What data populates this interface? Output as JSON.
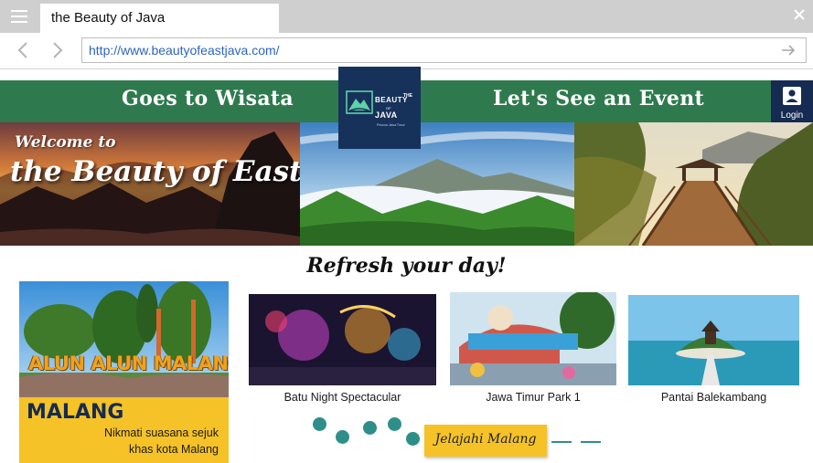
{
  "browser": {
    "tab_title": "the Beauty of Java",
    "url": "http://www.beautyofeastjava.com/",
    "icons": {
      "menu": "hamburger-menu-icon",
      "close": "close-icon",
      "back": "arrow-left-icon",
      "forward": "arrow-right-icon",
      "go": "arrow-go-icon"
    }
  },
  "site_nav": {
    "left_link": "Goes to Wisata",
    "right_link": "Let's See an Event",
    "login_label": "Login",
    "background_color": "#2e7a4e"
  },
  "logo": {
    "the": "THE",
    "beauty": "BEAUTY",
    "of": "OF",
    "java": "JAVA",
    "subtitle": "Pesona Jawa Timur",
    "background_color": "#17325a"
  },
  "hero": {
    "welcome": "Welcome to",
    "title": "the Beauty of East Java"
  },
  "main": {
    "tagline": "Refresh your day!",
    "featured": {
      "photo_sign": "ALUN ALUN MALANG",
      "city": "MALANG",
      "description_line1": "Nikmati suasana sejuk",
      "description_line2": "khas kota Malang",
      "card_color": "#f5c228"
    },
    "places": [
      {
        "label": "Batu Night Spectacular"
      },
      {
        "label": "Jawa Timur Park 1"
      },
      {
        "label": "Pantai Balekambang"
      }
    ],
    "explore_button": "Jelajahi Malang",
    "accent_color": "#2e8f8a"
  }
}
